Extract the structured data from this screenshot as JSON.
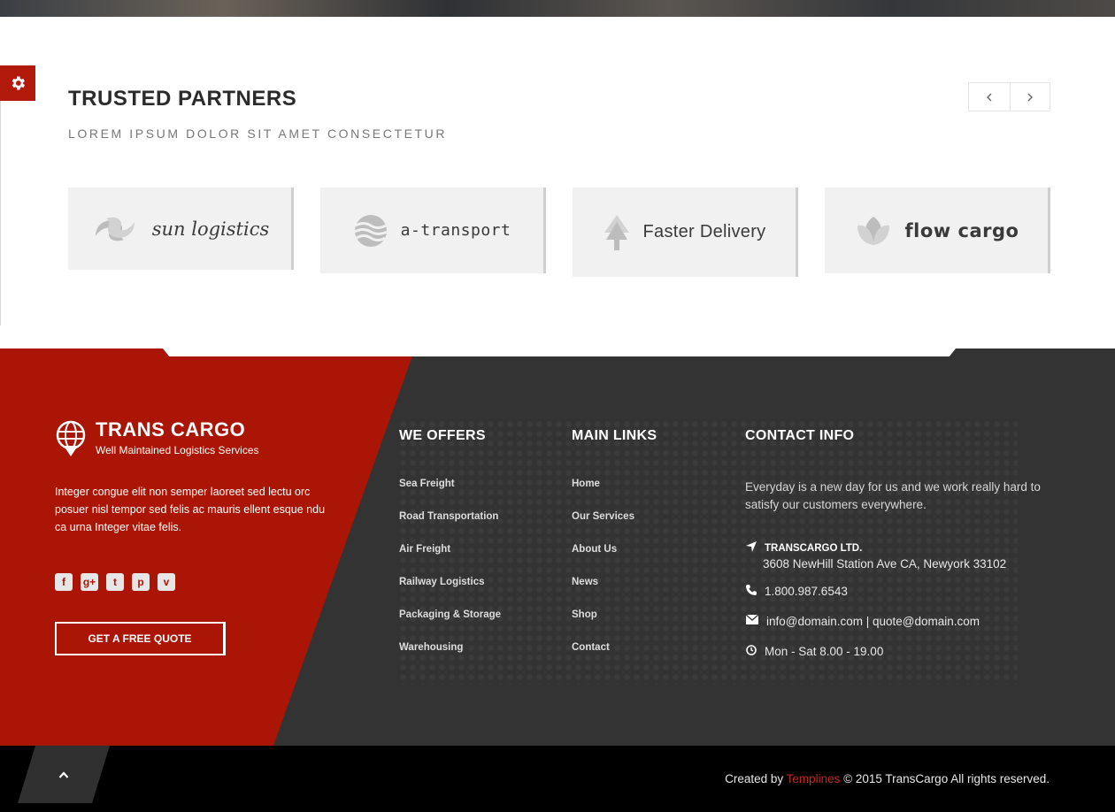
{
  "partners": {
    "title": "TRUSTED PARTNERS",
    "subtitle": "LOREM IPSUM DOLOR SIT AMET CONSECTETUR",
    "prev_icon": "chevron-left-icon",
    "next_icon": "chevron-right-icon",
    "logos": [
      {
        "name": "sun logistics",
        "icon": "swirl-logo-icon"
      },
      {
        "name": "a-transport",
        "icon": "waves-logo-icon"
      },
      {
        "name": "Faster Delivery",
        "icon": "arrow-tree-logo-icon"
      },
      {
        "name": "flow cargo",
        "icon": "leaf-logo-icon"
      }
    ]
  },
  "footer": {
    "brand": {
      "name": "TRANS CARGO",
      "tagline": "Well Maintained Logistics Services",
      "icon": "globe-pin-icon"
    },
    "about": "Integer congue elit non semper laoreet sed lectu orc posuer nisl tempor sed felis ac mauris ellent esque ndu ca urna Integer vitae felis.",
    "socials": [
      {
        "name": "facebook-icon",
        "glyph": "f"
      },
      {
        "name": "google-plus-icon",
        "glyph": "g+"
      },
      {
        "name": "twitter-icon",
        "glyph": "t"
      },
      {
        "name": "pinterest-icon",
        "glyph": "p"
      },
      {
        "name": "vimeo-icon",
        "glyph": "v"
      }
    ],
    "quote_button": "GET A FREE QUOTE",
    "offers": {
      "title": "WE OFFERS",
      "items": [
        "Sea Freight",
        "Road Transportation",
        "Air Freight",
        "Railway Logistics",
        "Packaging & Storage",
        "Warehousing"
      ]
    },
    "links": {
      "title": "MAIN LINKS",
      "items": [
        "Home",
        "Our Services",
        "About Us",
        "News",
        "Shop",
        "Contact"
      ]
    },
    "contact": {
      "title": "CONTACT INFO",
      "intro": "Everyday is a new day for us and we work really hard to satisfy our customers everywhere.",
      "company": "TRANSCARGO LTD.",
      "address": "3608 NewHill Station Ave CA, Newyork 33102",
      "phone": "1.800.987.6543",
      "email": "info@domain.com | quote@domain.com",
      "hours": "Mon - Sat 8.00 - 19.00"
    }
  },
  "bottom": {
    "created_by": "Created by",
    "author": "Templines",
    "rights": "© 2015 TransCargo All rights reserved.",
    "scroll_icon": "chevron-up-icon"
  },
  "colors": {
    "accent": "#ab1505",
    "footer_dark": "#333333",
    "bottom_bar": "#000000"
  }
}
